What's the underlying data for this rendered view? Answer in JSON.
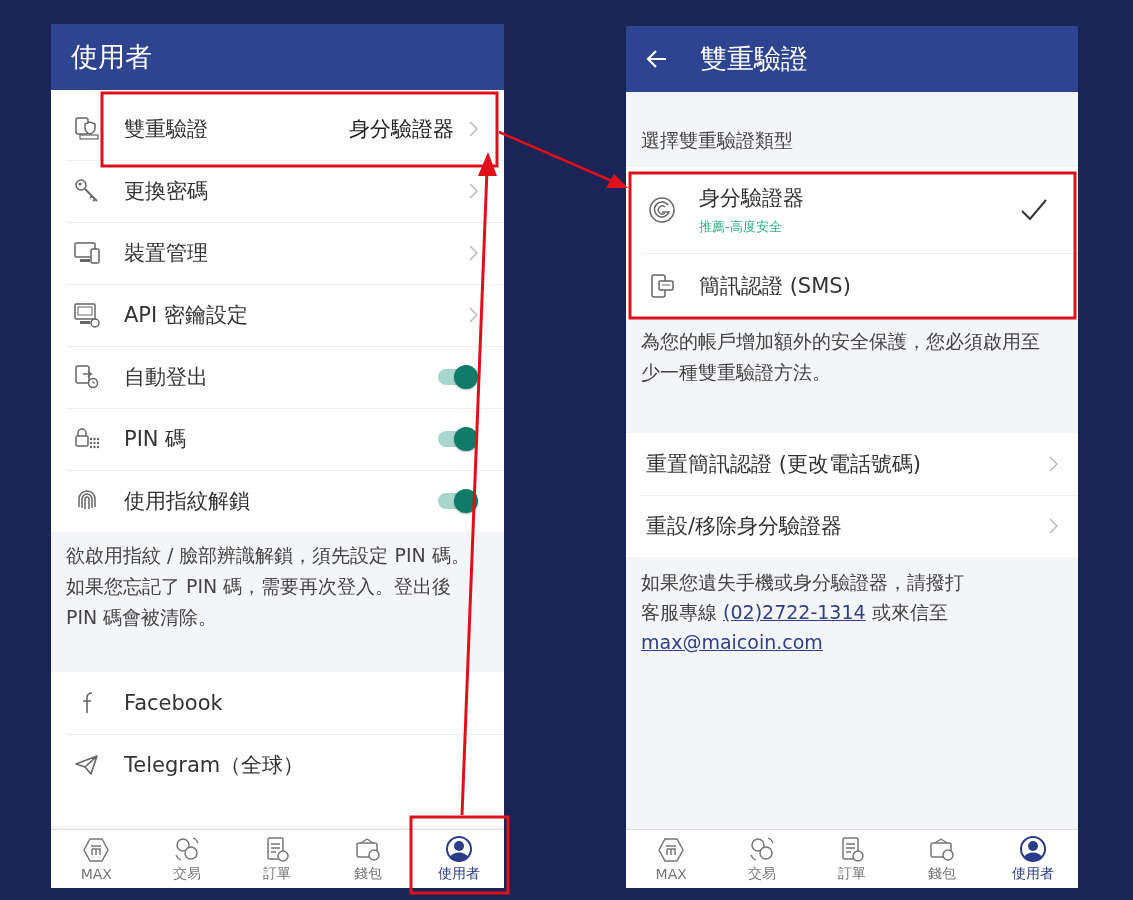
{
  "user_screen": {
    "title": "使用者",
    "settings": [
      {
        "kind": "link",
        "label": "雙重驗證",
        "value": "身分驗證器"
      },
      {
        "kind": "link",
        "label": "更換密碼"
      },
      {
        "kind": "link",
        "label": "裝置管理"
      },
      {
        "kind": "link",
        "label": "API 密鑰設定"
      },
      {
        "kind": "toggle",
        "label": "自動登出",
        "on": true
      },
      {
        "kind": "toggle",
        "label": "PIN 碼",
        "on": true
      },
      {
        "kind": "toggle",
        "label": "使用指紋解鎖",
        "on": true
      }
    ],
    "note": "欲啟用指紋 / 臉部辨識解鎖，須先設定 PIN 碼。如果您忘記了 PIN 碼，需要再次登入。登出後 PIN 碼會被清除。",
    "social": [
      {
        "label": "Facebook"
      },
      {
        "label": "Telegram（全球）"
      }
    ],
    "nav": [
      {
        "label": "MAX",
        "selected": false
      },
      {
        "label": "交易",
        "selected": false
      },
      {
        "label": "訂單",
        "selected": false
      },
      {
        "label": "錢包",
        "selected": false
      },
      {
        "label": "使用者",
        "selected": true
      }
    ]
  },
  "two_factor_screen": {
    "title": "雙重驗證",
    "section_label": "選擇雙重驗證類型",
    "options": [
      {
        "label": "身分驗證器",
        "sublabel": "推薦-高度安全",
        "selected": true
      },
      {
        "label": "簡訊認證 (SMS)",
        "selected": false
      }
    ],
    "note": "為您的帳戶增加額外的安全保護，您必須啟用至少一種雙重驗證方法。",
    "actions": [
      {
        "label": "重置簡訊認證 (更改電話號碼)"
      },
      {
        "label": "重設/移除身分驗證器"
      }
    ],
    "contact": {
      "text_before": "如果您遺失手機或身分驗證器，請撥打客服專線",
      "phone": "(02)2722-1314",
      "text_middle": "或來信至",
      "email": "max@maicoin.com"
    },
    "nav": [
      {
        "label": "MAX",
        "selected": false
      },
      {
        "label": "交易",
        "selected": false
      },
      {
        "label": "訂單",
        "selected": false
      },
      {
        "label": "錢包",
        "selected": false
      },
      {
        "label": "使用者",
        "selected": true
      }
    ]
  }
}
